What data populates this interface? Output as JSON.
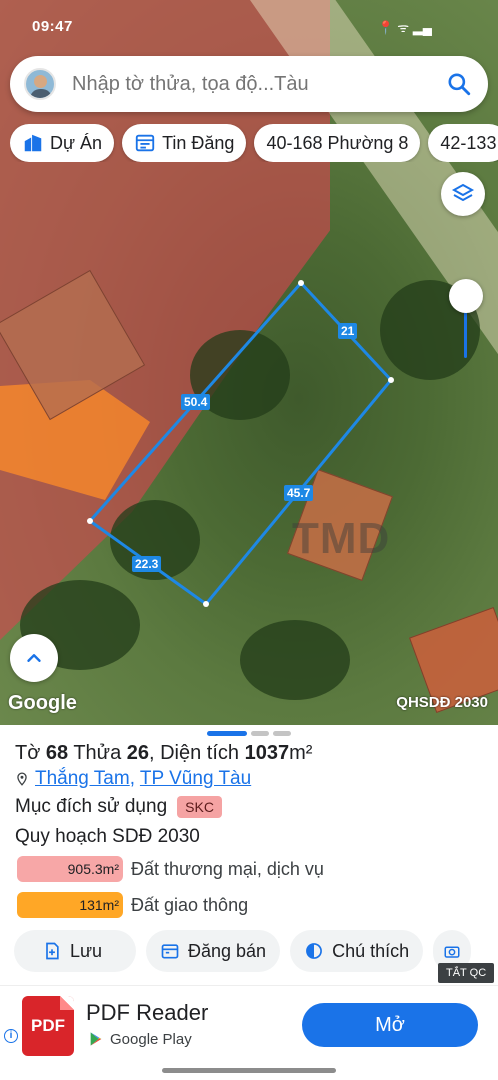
{
  "status_bar": {
    "time": "09:47",
    "icons": "📍 ᯤ ▂▄"
  },
  "search": {
    "placeholder": "Nhập tờ thửa, tọa độ...Tàu"
  },
  "chips": [
    {
      "label": "Dự Án",
      "icon": "building-icon"
    },
    {
      "label": "Tin Đăng",
      "icon": "listing-icon"
    },
    {
      "label": "40-168 Phường 8"
    },
    {
      "label": "42-133"
    }
  ],
  "map": {
    "edge_lengths": {
      "top_right": "21",
      "top_left": "50.4",
      "right": "45.7",
      "bottom": "22.3"
    },
    "watermark": "TMD",
    "logo": "Google",
    "overlay_name": "QHSDĐ 2030",
    "colors": {
      "commercial_zone": "#d64650",
      "transport_zone": "#ff8c28",
      "parcel_outline": "#1e88e5"
    }
  },
  "parcel": {
    "title_prefix": "Tờ ",
    "sheet_no": "68",
    "mid1": " Thửa ",
    "plot_no": "26",
    "mid2": ", Diện tích ",
    "area": "1037",
    "area_unit": "m²",
    "ward": "Thắng Tam",
    "separator": ",",
    "city": "TP Vũng Tàu",
    "purpose_label": "Mục đích sử dụng",
    "purpose_code": "SKC",
    "plan_label": "Quy hoạch SDĐ 2030",
    "usage": [
      {
        "area": "905.3m²",
        "label": "Đất thương mại, dịch vụ",
        "color": "#f7a7a7"
      },
      {
        "area": "131m²",
        "label": "Đất giao thông",
        "color": "#ffa726"
      }
    ]
  },
  "actions": [
    {
      "label": "Lưu",
      "icon": "save-icon"
    },
    {
      "label": "Đăng bán",
      "icon": "calendar-icon"
    },
    {
      "label": "Chú thích",
      "icon": "legend-icon"
    },
    {
      "label": "",
      "icon": "camera-icon"
    }
  ],
  "ad": {
    "close_label": "TẮT QC",
    "app_icon_text": "PDF",
    "app_name": "PDF Reader",
    "store": "Google Play",
    "open_label": "Mở"
  }
}
